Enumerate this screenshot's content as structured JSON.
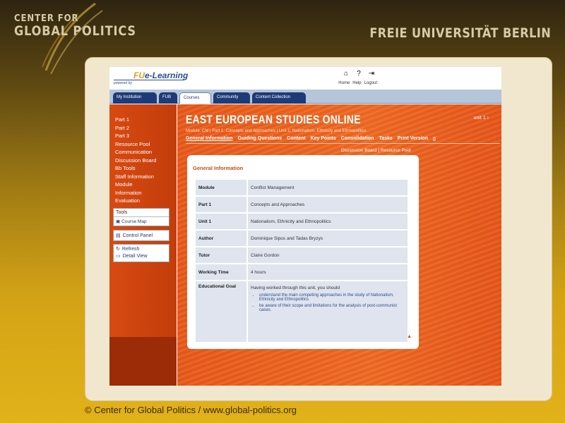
{
  "branding": {
    "left_line1": "CENTER FOR",
    "left_line2": "GLOBAL POLITICS",
    "right": "FREIE UNIVERSITÄT BERLIN"
  },
  "header": {
    "logo_prefix": "FU",
    "logo_suffix": "e-Learning",
    "powered_by": "powered by",
    "util_links": [
      "Home",
      "Help",
      "Logout"
    ]
  },
  "tabs": [
    {
      "label": "My Institution"
    },
    {
      "label": "FUB"
    },
    {
      "label": "Courses"
    },
    {
      "label": "Community"
    },
    {
      "label": "Content Collection"
    }
  ],
  "sidebar": {
    "items": [
      "Part 1",
      "Part 2",
      "Part 3",
      "Resource Pool",
      "Communication",
      "Discussion Board",
      "Bb Tools",
      "Staff Information",
      "Module",
      "Information",
      "Evaluation"
    ],
    "tools_title": "Tools",
    "tools_item": "Course Map",
    "control_panel": "Control Panel",
    "refresh": "Refresh",
    "detail_view": "Detail View"
  },
  "main": {
    "title": "EAST EUROPEAN STUDIES ONLINE",
    "unit_link": "unit 1 ›",
    "breadcrumb": "Module: CM  |  Part 1: Concepts and Approaches  |  Unit 1: Nationalism, Ethnicity and Ethnopolitics",
    "subnav": [
      "General Information",
      "Guiding Questions",
      "Content",
      "Key Points",
      "Consolidation",
      "Tasks",
      "Print Version"
    ],
    "subnav2": "Discussion Board  |  Resource Pool",
    "card": {
      "title": "General Information",
      "rows": [
        {
          "key": "Module",
          "value": "Conflict Management"
        },
        {
          "key": "Part 1",
          "value": "Concepts and Approaches"
        },
        {
          "key": "Unit 1",
          "value": "Nationalism, Ethnicity and Ethnopolitics"
        },
        {
          "key": "Author",
          "value": "Dominique Sipos and Tadas Bryzys"
        },
        {
          "key": "Tutor",
          "value": "Claire Gordon"
        },
        {
          "key": "Working Time",
          "value": "4 hours"
        }
      ],
      "goal_key": "Educational Goal",
      "goal_intro": "Having worked through this unit, you should",
      "goal_bullets": [
        "understand the main competing approaches in the study of Nationalism, Ethnicity and Ethnopolitics",
        "be aware of their scope and limitations for the analysis of post-communist cases."
      ],
      "top_link": "▲"
    }
  },
  "footer": "© Center for Global Politics / www.global-politics.org"
}
